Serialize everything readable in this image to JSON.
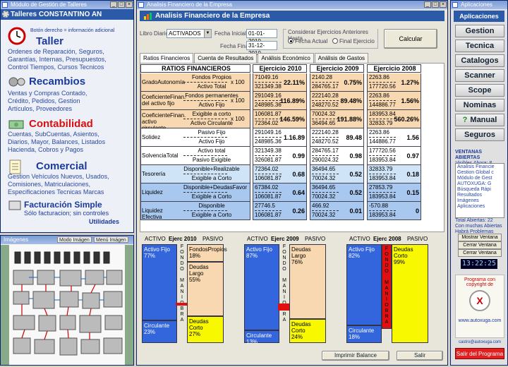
{
  "left_window": {
    "title": "Módulo de Gestión de Talleres",
    "header": "Talleres CONSTANTINO AN",
    "hint": "Botón derecho = información adicional",
    "sections": [
      {
        "title": "Taller",
        "color": "#1a3a9a",
        "text": [
          "Ordenes de Reparación, Seguros,",
          "Garantías, Internas, Presupuestos,",
          "Control Tiempos, Cursos Tecnicos"
        ]
      },
      {
        "title": "Recambios",
        "color": "#1a3a9a",
        "text": [
          "Ventas y Compras Contado,",
          "Crédito, Pedidos,  Gestion",
          "Artículos, Proveedores"
        ]
      },
      {
        "title": "Contabilidad",
        "color": "#d81010",
        "text": [
          "Cuentas, SubCuentas, Asientos,",
          "Diarios, Mayor, Balances, Listados",
          "Hacienda, Cobros y Pagos"
        ]
      },
      {
        "title": "Comercial",
        "color": "#1a3a9a",
        "text": [
          "Gestion Vehículos Nuevos, Usados,",
          "Comisiones, Matriculaciones,",
          "Especificaciones Tecnicas Marcas"
        ]
      }
    ],
    "facturacion": {
      "title": "Facturación Simple",
      "sub": "Sólo facturacion; sin controles"
    },
    "utilidades": "Utilidades"
  },
  "gallery": {
    "title": "Imágenes",
    "mode1": "Modo Imágen",
    "mode2": "Menú Imágen"
  },
  "main_window": {
    "title": "Analisis Financiero de la Empresa",
    "header": "Analisis Financiero de la Empresa",
    "libro_label": "Libro Diario",
    "libro_value": "ACTIVADOS",
    "fecha_inicial_label": "Fecha Inicial",
    "fecha_inicial": "01-01-2010",
    "fecha_final_label": "Fecha Final",
    "fecha_final": "31-12-2010",
    "considerar_label": "Considerar Ejercicios Anteriores Hasta",
    "radio_actual": "Fecha Actual",
    "radio_final": "Final Ejercicio",
    "calcular": "Calcular",
    "tabs": [
      "Ratios Financieros",
      "Cuenta de Resultados",
      "Análisis Económico",
      "Análisis de Gastos"
    ],
    "ratios_header": "RATIOS FINANCIEROS",
    "years": [
      "Ejercicio 2010",
      "Ejercicio 2009",
      "Ejercicio 2008"
    ],
    "ratios": [
      {
        "name": "GradoAutonomía",
        "num": "Fondos Propios",
        "den": "Activo Total",
        "x100": "x 100",
        "vals": [
          [
            "71049.16",
            "321349.38",
            "22.11%"
          ],
          [
            "2140.28",
            "284765.17",
            "0.75%"
          ],
          [
            "2263.86",
            "177720.56",
            "1.27%"
          ]
        ]
      },
      {
        "name": "CoeficienteFinan. del activo fijo",
        "num": "Fondos permanentes",
        "den": "Activo Fijo",
        "x100": "x 100",
        "vals": [
          [
            "291049.16",
            "248985.36",
            "116.89%"
          ],
          [
            "222140.28",
            "248270.52",
            "89.48%"
          ],
          [
            "2263.86",
            "144886.77",
            "1.56%"
          ]
        ]
      },
      {
        "name": "CoeficienteFinan. activo circulante",
        "num": "Exigible a corto",
        "den": "Activo Circulante",
        "x100": "x 100",
        "vals": [
          [
            "106081.87",
            "72364.02",
            "146.59%"
          ],
          [
            "70024.32",
            "36494.65",
            "191.88%"
          ],
          [
            "183953.84",
            "32833.79",
            "560.26%"
          ]
        ]
      },
      {
        "name": "Solidez",
        "num": "Pasivo Fijo",
        "den": "Activo Fijo",
        "x100": "",
        "vals": [
          [
            "291049.16",
            "248985.36",
            "1.16.89"
          ],
          [
            "222140.28",
            "248270.52",
            "89.48"
          ],
          [
            "2263.86",
            "144886.77",
            "1.56"
          ]
        ]
      },
      {
        "name": "SolvenciaTotal",
        "num": "Activo total",
        "den": "Pasivo Exigible",
        "x100": "",
        "vals": [
          [
            "321349.38",
            "326081.87",
            "0.99"
          ],
          [
            "284765.17",
            "290024.32",
            "0.98"
          ],
          [
            "177720.56",
            "183953.84",
            "0.97"
          ]
        ]
      },
      {
        "name": "Tesorería",
        "num": "Disponible+Realizable",
        "den": "Exigible a Corto",
        "x100": "",
        "vals": [
          [
            "72364.02",
            "106081.87",
            "0.68"
          ],
          [
            "36494.65",
            "70024.32",
            "0.52"
          ],
          [
            "32833.79",
            "183953.84",
            "0.18"
          ]
        ]
      },
      {
        "name": "Liquidez",
        "num": "Disponible+DeudasFavor",
        "den": "Exigible a Corto",
        "x100": "",
        "vals": [
          [
            "67384.02",
            "106081.87",
            "0.64"
          ],
          [
            "36494.65",
            "70024.32",
            "0.52"
          ],
          [
            "27853.79",
            "183953.84",
            "0.15"
          ]
        ]
      },
      {
        "name": "Liquidez Efectiva",
        "num": "Disponible",
        "den": "Exigible a Corto",
        "x100": "",
        "vals": [
          [
            "27746.5",
            "106081.87",
            "0.26"
          ],
          [
            "466.92",
            "70024.32",
            "0.01"
          ],
          [
            "-570.88",
            "183953.84",
            "0"
          ]
        ]
      }
    ],
    "charts": [
      {
        "activo": "ACTIVO",
        "ejerc": "Ejerc 2010",
        "pasivo": "PASIVO",
        "fijo_label": "Activo Fijo",
        "fijo_pct": "77%",
        "circ_label": "Circulante",
        "circ_pct": "23%",
        "fondos_label": "FondosPropios",
        "fondos_pct": "18%",
        "largo_label": "Deudas Largo",
        "largo_pct": "55%",
        "corto_label": "Deudas Corto",
        "corto_pct": "27%"
      },
      {
        "activo": "ACTIVO",
        "ejerc": "Ejerc 2009",
        "pasivo": "PASIVO",
        "fijo_label": "Activo Fijo",
        "fijo_pct": "87%",
        "circ_label": "Circulante",
        "circ_pct": "13%",
        "fondos_label": "Deudas Largo",
        "fondos_pct": "76%",
        "largo_label": "",
        "largo_pct": "",
        "corto_label": "Deudas Corto",
        "corto_pct": "24%"
      },
      {
        "activo": "ACTIVO",
        "ejerc": "Ejerc 2008",
        "pasivo": "PASIVO",
        "fijo_label": "Activo Fijo",
        "fijo_pct": "82%",
        "circ_label": "Circulante",
        "circ_pct": "18%",
        "fondos_label": "Deudas Corto",
        "fondos_pct": "99%",
        "largo_label": "",
        "largo_pct": "",
        "corto_label": "",
        "corto_pct": ""
      }
    ],
    "fondo_maniobra": [
      "F",
      "O",
      "N",
      "D",
      "O",
      "",
      "M",
      "A",
      "N",
      "I",
      "O",
      "B",
      "R",
      "A"
    ],
    "imprimir": "Imprimir Balance",
    "salir": "Salir"
  },
  "right_window": {
    "title": "Aplicaciones",
    "header": "Aplicaciones",
    "buttons": [
      "Gestion",
      "Tecnica",
      "Catalogos",
      "Scanner",
      "Scope",
      "Nominas",
      "Manual",
      "Seguros"
    ],
    "ventanas_title": "VENTANAS ABIERTAS",
    "visibles": "Visibles Ahora: 8",
    "list": [
      "Analisis Financie",
      "Gestion Global c",
      "Módulo de Gest",
      "AUTOXUGA: G",
      "Búsqueda Rápi",
      "Resultados",
      "Imágenes",
      "Aplicaciones"
    ],
    "total": "Total Abiertas: 22",
    "note1": "Con muchas Abiertas",
    "note2": "Habrá Problemas",
    "mostrar": "Mostrar Ventana",
    "cerrar": "Cerrar Ventana",
    "cerrar2": "Cerrar Ventana",
    "clock": "13:22:25",
    "copy1": "Programa con",
    "copy2": "copyright de",
    "web": "www.autoxuga.com",
    "email": "castro@autoxuga.com",
    "salir_prog": "Salir del Programa"
  },
  "colors": {
    "orange_row": "#f8d8b0",
    "blue_row": "#a8c8f0",
    "blue_light": "#d0e4f8",
    "bar_blue": "#3366dd",
    "bar_peach": "#f8d8b0",
    "bar_yellow": "#f8f800",
    "bar_red": "#e01010"
  }
}
